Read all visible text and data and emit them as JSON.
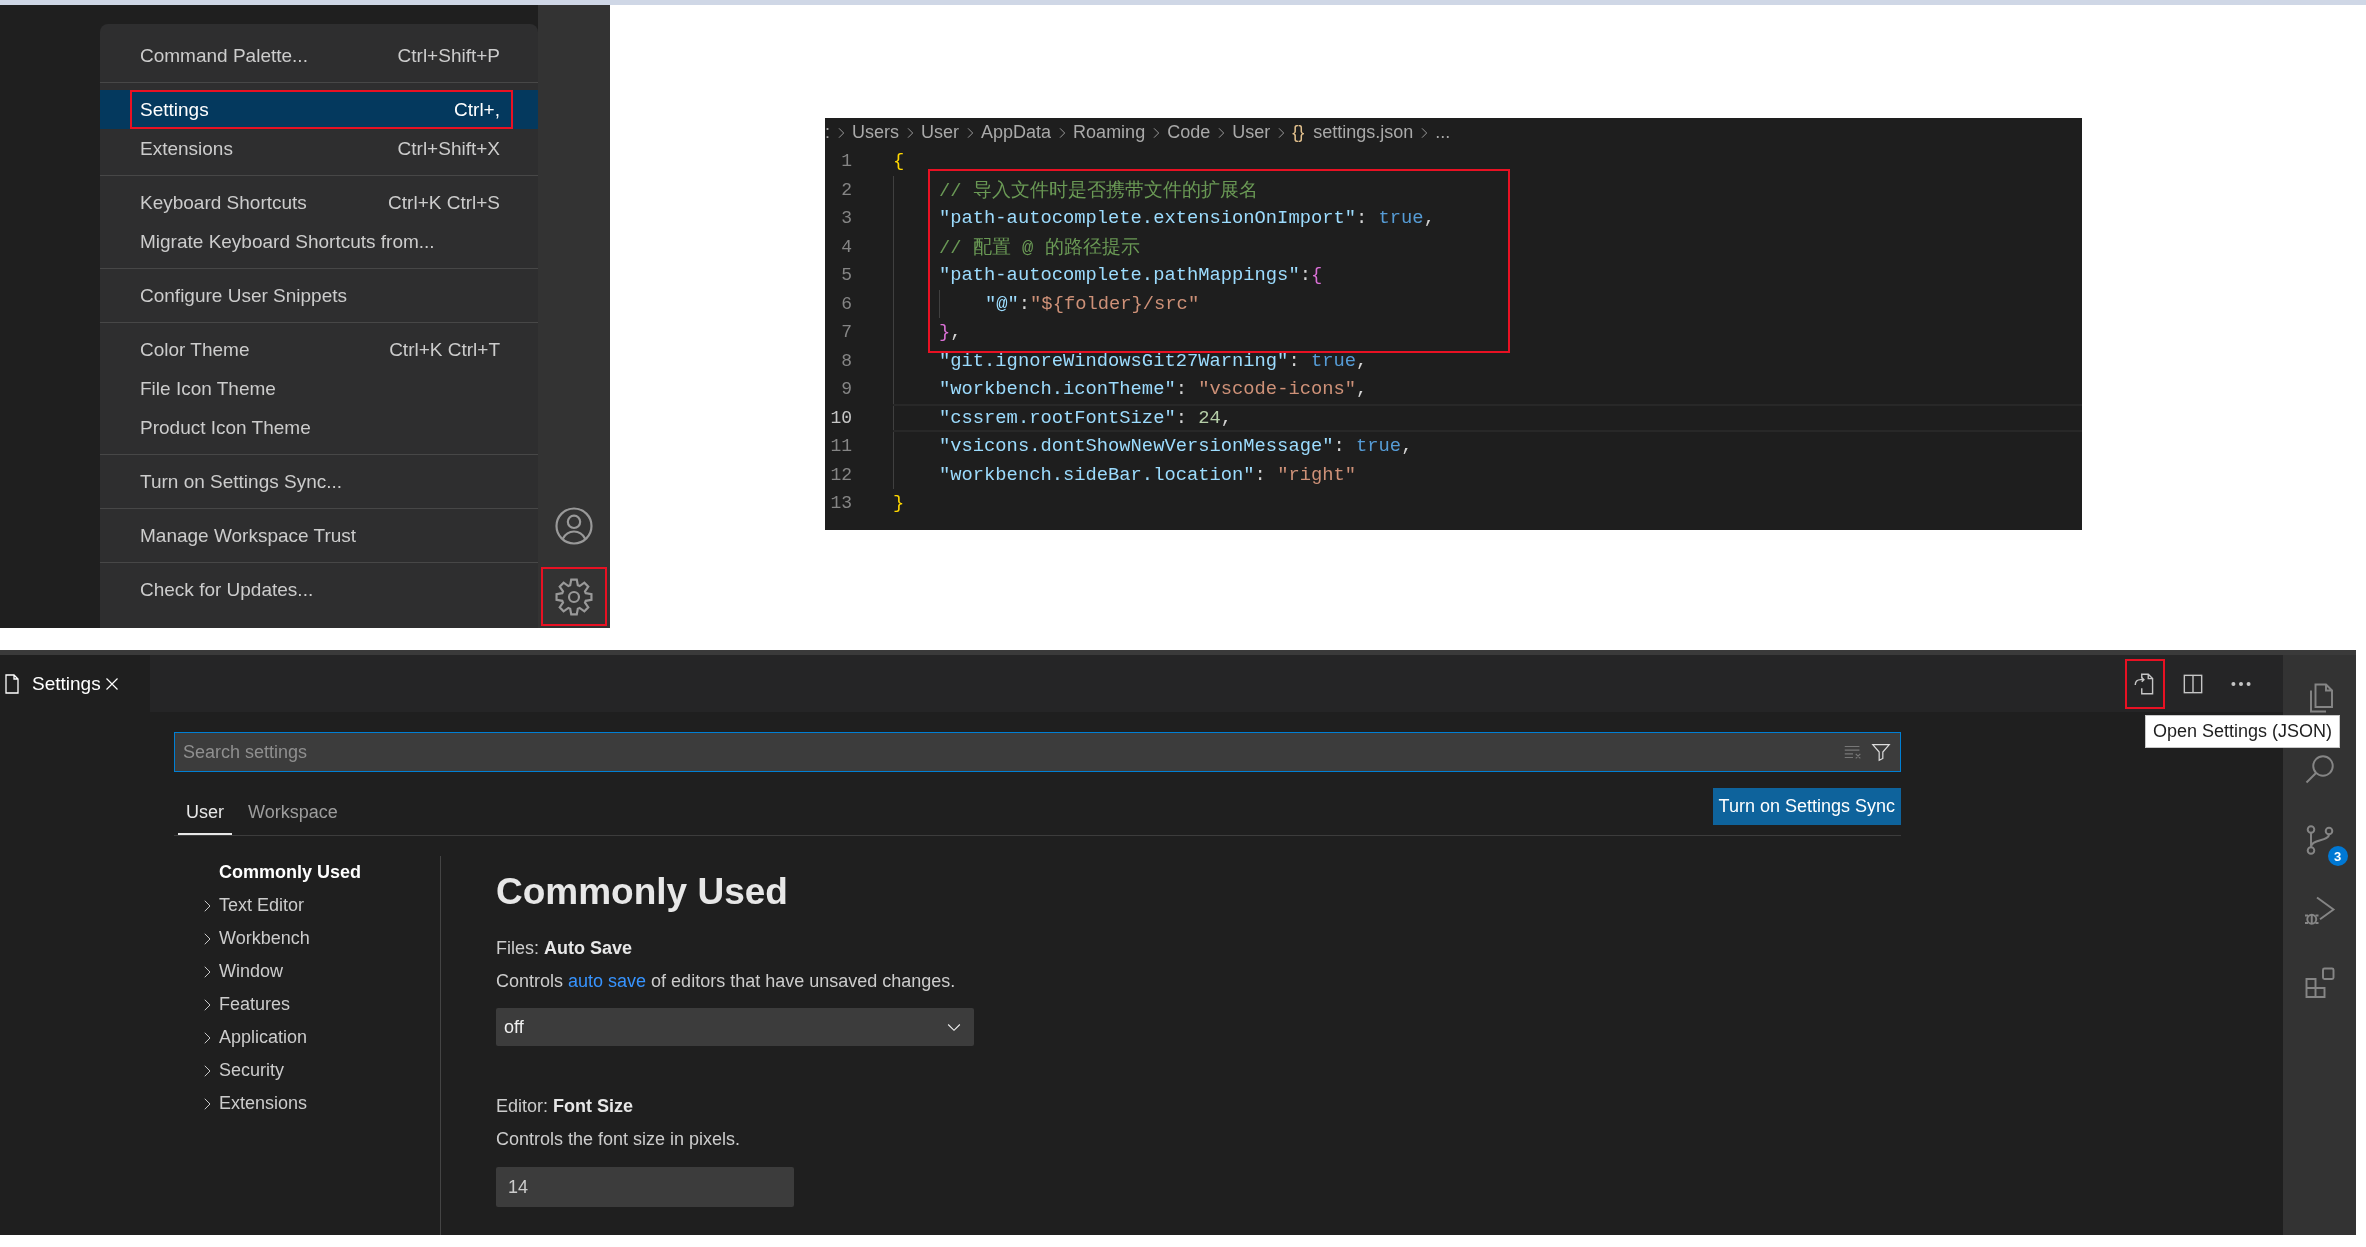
{
  "menu_panel": {
    "menu": {
      "groups": [
        [
          {
            "label": "Command Palette...",
            "shortcut": "Ctrl+Shift+P",
            "selected": false,
            "annotated": false
          }
        ],
        [
          {
            "label": "Settings",
            "shortcut": "Ctrl+,",
            "selected": true,
            "annotated": true
          },
          {
            "label": "Extensions",
            "shortcut": "Ctrl+Shift+X",
            "selected": false,
            "annotated": false
          }
        ],
        [
          {
            "label": "Keyboard Shortcuts",
            "shortcut": "Ctrl+K Ctrl+S",
            "selected": false,
            "annotated": false
          },
          {
            "label": "Migrate Keyboard Shortcuts from...",
            "selected": false,
            "annotated": false
          }
        ],
        [
          {
            "label": "Configure User Snippets",
            "selected": false,
            "annotated": false
          }
        ],
        [
          {
            "label": "Color Theme",
            "shortcut": "Ctrl+K Ctrl+T",
            "selected": false,
            "annotated": false
          },
          {
            "label": "File Icon Theme",
            "selected": false,
            "annotated": false
          },
          {
            "label": "Product Icon Theme",
            "selected": false,
            "annotated": false
          }
        ],
        [
          {
            "label": "Turn on Settings Sync...",
            "selected": false,
            "annotated": false
          }
        ],
        [
          {
            "label": "Manage Workspace Trust",
            "selected": false,
            "annotated": false
          }
        ],
        [
          {
            "label": "Check for Updates...",
            "selected": false,
            "annotated": false
          }
        ]
      ]
    },
    "activity_bar": [
      {
        "kind": "account",
        "annotated": false
      },
      {
        "kind": "settings",
        "annotated": true
      }
    ]
  },
  "editor": {
    "breadcrumbs": [
      {
        "label": ":"
      },
      {
        "label": "Users"
      },
      {
        "label": "User"
      },
      {
        "label": "AppData"
      },
      {
        "label": "Roaming"
      },
      {
        "label": "Code"
      },
      {
        "label": "User"
      },
      {
        "icon": "{}",
        "label": "settings.json"
      },
      {
        "label": "..."
      }
    ],
    "lines": [
      {
        "number": "1",
        "current": false,
        "annotated": false,
        "tokens": [
          {
            "kind": "bracket1",
            "text": "{"
          }
        ],
        "children": [
          {
            "number": "2",
            "current": false,
            "annotated": true,
            "tokens": [
              {
                "kind": "comment",
                "text": "// 导入文件时是否携带文件的扩展名"
              }
            ]
          },
          {
            "number": "3",
            "current": false,
            "annotated": true,
            "tokens": [
              {
                "kind": "key",
                "text": "\"path-autocomplete.extensionOnImport\""
              },
              {
                "kind": "punct",
                "text": ": "
              },
              {
                "kind": "keyword",
                "text": "true"
              },
              {
                "kind": "punct",
                "text": ","
              }
            ]
          },
          {
            "number": "4",
            "current": false,
            "annotated": true,
            "tokens": [
              {
                "kind": "comment",
                "text": "// 配置 @ 的路径提示"
              }
            ]
          },
          {
            "number": "5",
            "current": false,
            "annotated": true,
            "tokens": [
              {
                "kind": "key",
                "text": "\"path-autocomplete.pathMappings\""
              },
              {
                "kind": "punct",
                "text": ":"
              },
              {
                "kind": "bracket2",
                "text": "{"
              }
            ],
            "children": [
              {
                "number": "6",
                "current": false,
                "annotated": true,
                "tokens": [
                  {
                    "kind": "key",
                    "text": "\"@\""
                  },
                  {
                    "kind": "punct",
                    "text": ":"
                  },
                  {
                    "kind": "string",
                    "text": "\"${folder}/src\""
                  }
                ]
              }
            ]
          },
          {
            "number": "7",
            "current": false,
            "annotated": true,
            "tokens": [
              {
                "kind": "bracket2",
                "text": "}"
              },
              {
                "kind": "punct",
                "text": ","
              }
            ]
          },
          {
            "number": "8",
            "current": false,
            "annotated": false,
            "tokens": [
              {
                "kind": "key",
                "text": "\"git.ignoreWindowsGit27Warning\""
              },
              {
                "kind": "punct",
                "text": ": "
              },
              {
                "kind": "keyword",
                "text": "true"
              },
              {
                "kind": "punct",
                "text": ","
              }
            ]
          },
          {
            "number": "9",
            "current": false,
            "annotated": false,
            "tokens": [
              {
                "kind": "key",
                "text": "\"workbench.iconTheme\""
              },
              {
                "kind": "punct",
                "text": ": "
              },
              {
                "kind": "string",
                "text": "\"vscode-icons\""
              },
              {
                "kind": "punct",
                "text": ","
              }
            ]
          },
          {
            "number": "10",
            "current": true,
            "annotated": false,
            "tokens": [
              {
                "kind": "key",
                "text": "\"cssrem.rootFontSize\""
              },
              {
                "kind": "punct",
                "text": ": "
              },
              {
                "kind": "number",
                "text": "24"
              },
              {
                "kind": "punct",
                "text": ","
              }
            ]
          },
          {
            "number": "11",
            "current": false,
            "annotated": false,
            "tokens": [
              {
                "kind": "key",
                "text": "\"vsicons.dontShowNewVersionMessage\""
              },
              {
                "kind": "punct",
                "text": ": "
              },
              {
                "kind": "keyword",
                "text": "true"
              },
              {
                "kind": "punct",
                "text": ","
              }
            ]
          },
          {
            "number": "12",
            "current": false,
            "annotated": false,
            "tokens": [
              {
                "kind": "key",
                "text": "\"workbench.sideBar.location\""
              },
              {
                "kind": "punct",
                "text": ": "
              },
              {
                "kind": "string",
                "text": "\"right\""
              }
            ]
          }
        ]
      },
      {
        "number": "13",
        "current": false,
        "annotated": false,
        "tokens": [
          {
            "kind": "bracket1",
            "text": "}"
          }
        ]
      }
    ]
  },
  "settings_editor": {
    "tab": {
      "label": "Settings"
    },
    "actions": [
      {
        "kind": "open-json",
        "annotated": true
      },
      {
        "kind": "split",
        "annotated": false
      },
      {
        "kind": "more",
        "annotated": false
      }
    ],
    "tooltip": "Open Settings (JSON)",
    "search": {
      "placeholder": "Search settings"
    },
    "scopes": [
      {
        "label": "User",
        "selected": true
      },
      {
        "label": "Workspace",
        "selected": false
      }
    ],
    "sync_button": "Turn on Settings Sync",
    "toc": [
      {
        "label": "Commonly Used",
        "kind": "heading",
        "selected": true
      },
      {
        "label": "Text Editor",
        "kind": "group",
        "selected": false
      },
      {
        "label": "Workbench",
        "kind": "group",
        "selected": false
      },
      {
        "label": "Window",
        "kind": "group",
        "selected": false
      },
      {
        "label": "Features",
        "kind": "group",
        "selected": false
      },
      {
        "label": "Application",
        "kind": "group",
        "selected": false
      },
      {
        "label": "Security",
        "kind": "group",
        "selected": false
      },
      {
        "label": "Extensions",
        "kind": "group",
        "selected": false
      }
    ],
    "section_title": "Commonly Used",
    "settings": [
      {
        "kind": "dropdown",
        "title": "Files: **Auto Save**",
        "description": {
          "before": "Controls ",
          "link": "auto save",
          "after": " of editors that have unsaved changes."
        },
        "value": "off"
      },
      {
        "kind": "number",
        "title": "Editor: **Font Size**",
        "description": {
          "before": "Controls the font size in pixels."
        },
        "value": "14"
      }
    ],
    "activity_bar": [
      {
        "kind": "explorer"
      },
      {
        "kind": "search"
      },
      {
        "kind": "source-control",
        "badge": "3"
      },
      {
        "kind": "run-debug"
      },
      {
        "kind": "extensions"
      }
    ]
  }
}
